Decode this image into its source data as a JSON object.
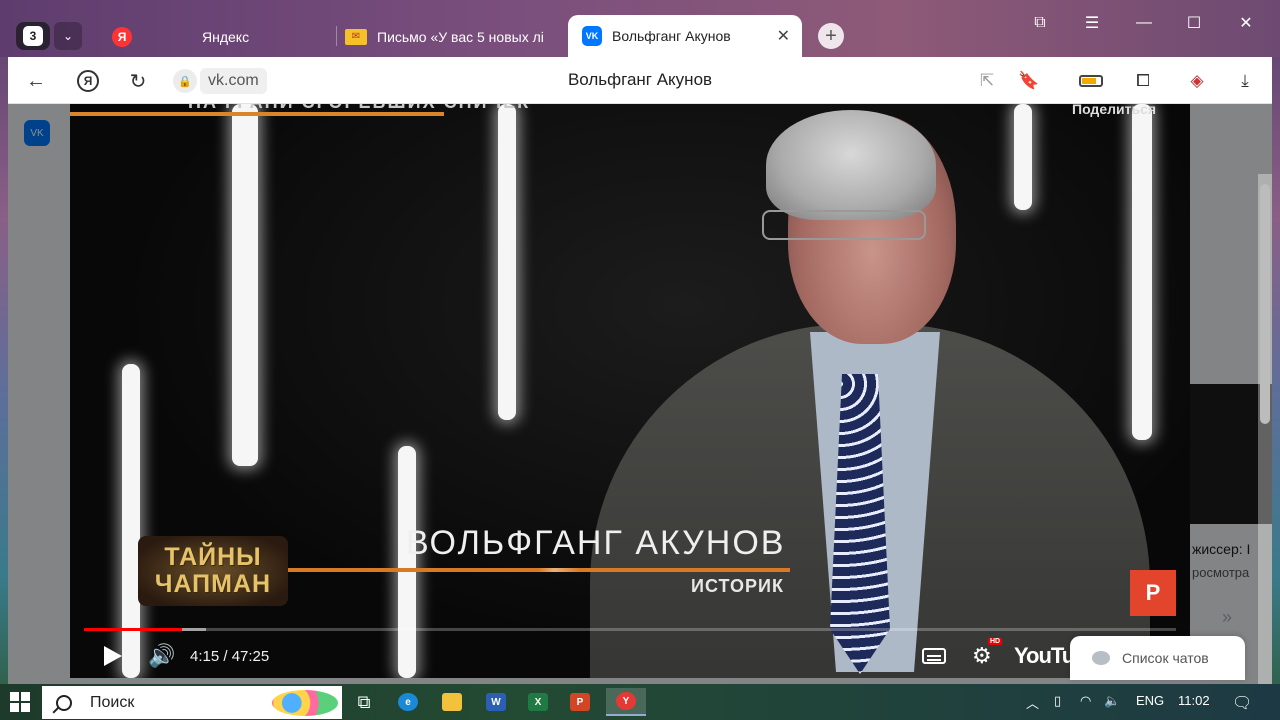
{
  "browser": {
    "tab_count": "3",
    "tabs": [
      {
        "label": "Яндекс",
        "icon": "yandex-icon"
      },
      {
        "label": "Письмо «У вас 5 новых лі",
        "icon": "mail-envelope-icon"
      },
      {
        "label": "Вольфганг Акунов",
        "icon": "vk-icon",
        "active": true
      }
    ],
    "url": "vk.com",
    "page_title": "Вольфганг Акунов",
    "vk_badge": "VK"
  },
  "video": {
    "top_caption": "НА ГРАНИ СГОРЕВШИХ СПИЧЕК",
    "share_label": "Поделиться",
    "show_title": "ТАЙНЫ ЧАПМАН",
    "speaker_name": "ВОЛЬФГАНГ АКУНОВ",
    "speaker_role": "ИСТОРИК",
    "channel_logo": "REN",
    "time_current": "4:15",
    "time_total": "47:25",
    "time_display": "4:15 / 47:25",
    "progress_fraction": 0.0896,
    "hd_label": "HD",
    "youtube_label": "YouTube"
  },
  "side": {
    "text1": "жиссер: I",
    "text2": "росмотра",
    "more": "»"
  },
  "chat": {
    "label": "Список чатов"
  },
  "taskbar": {
    "search_placeholder": "Поиск",
    "lang": "ENG",
    "clock": "11:02"
  },
  "colors": {
    "accent_progress": "#ff0000",
    "vk_blue": "#0077ff",
    "lower_third": "#d97a22"
  }
}
